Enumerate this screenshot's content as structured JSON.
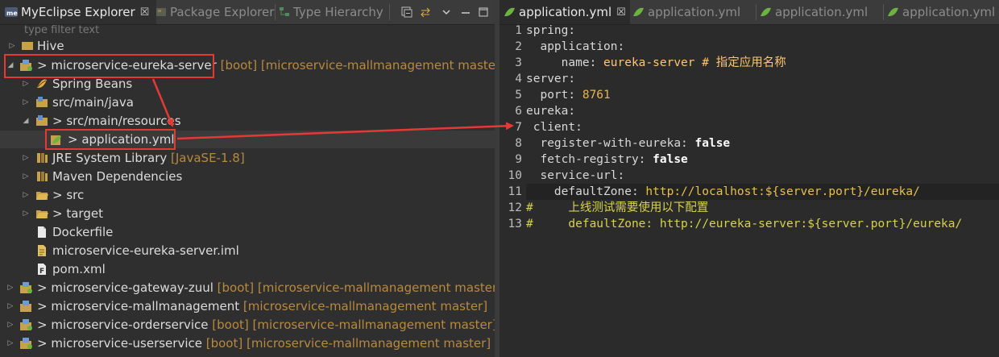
{
  "left_panel": {
    "tabs": [
      {
        "label": "MyEclipse Explorer",
        "icon": "me-icon",
        "active": true
      },
      {
        "label": "Package Explorer",
        "icon": "package-icon",
        "active": false
      },
      {
        "label": "Type Hierarchy",
        "icon": "hierarchy-icon",
        "active": false
      }
    ],
    "tab_close": "☒",
    "filter_placeholder": "type filter text",
    "tree": [
      {
        "text": "Hive",
        "decoration": ""
      },
      {
        "text": "> microservice-eureka-server",
        "decoration": " [boot] [microservice-mallmanagement master]"
      },
      {
        "text": "Spring Beans",
        "decoration": ""
      },
      {
        "text": "src/main/java",
        "decoration": ""
      },
      {
        "text": "> src/main/resources",
        "decoration": ""
      },
      {
        "text": "> application.yml",
        "decoration": ""
      },
      {
        "text": "JRE System Library",
        "decoration": " [JavaSE-1.8]"
      },
      {
        "text": "Maven Dependencies",
        "decoration": ""
      },
      {
        "text": "> src",
        "decoration": ""
      },
      {
        "text": "> target",
        "decoration": ""
      },
      {
        "text": "Dockerfile",
        "decoration": ""
      },
      {
        "text": "microservice-eureka-server.iml",
        "decoration": ""
      },
      {
        "text": "pom.xml",
        "decoration": ""
      },
      {
        "text": "> microservice-gateway-zuul",
        "decoration": " [boot] [microservice-mallmanagement master]"
      },
      {
        "text": "> microservice-mallmanagement",
        "decoration": " [microservice-mallmanagement master]"
      },
      {
        "text": "> microservice-orderservice",
        "decoration": " [boot] [microservice-mallmanagement master]"
      },
      {
        "text": "> microservice-userservice",
        "decoration": " [boot] [microservice-mallmanagement master]"
      }
    ]
  },
  "editor": {
    "tabs": [
      {
        "label": "application.yml",
        "active": true
      },
      {
        "label": "application.yml",
        "active": false
      },
      {
        "label": "application.yml",
        "active": false
      },
      {
        "label": "application.yml",
        "active": false
      }
    ],
    "tab_close": "☒",
    "lines": [
      {
        "n": "1",
        "k": "spring:",
        "v": ""
      },
      {
        "n": "2",
        "k": "  application:",
        "v": ""
      },
      {
        "n": "3",
        "k": "     name: ",
        "v": "eureka-server # 指定应用名称"
      },
      {
        "n": "4",
        "k": "server:",
        "v": ""
      },
      {
        "n": "5",
        "k": "  port: ",
        "v": "8761"
      },
      {
        "n": "6",
        "k": "eureka:",
        "v": ""
      },
      {
        "n": "7",
        "k": " client:",
        "v": ""
      },
      {
        "n": "8",
        "k": "  register-with-eureka: ",
        "v": "false"
      },
      {
        "n": "9",
        "k": "  fetch-registry: ",
        "v": "false"
      },
      {
        "n": "10",
        "k": "  service-url:",
        "v": ""
      },
      {
        "n": "11",
        "k": "    defaultZone: ",
        "v": "http://localhost:${server.port}/eureka/"
      },
      {
        "n": "12",
        "k": "#",
        "v": "     上线测试需要使用以下配置"
      },
      {
        "n": "13",
        "k": "#",
        "v": "     defaultZone: http://eureka-server:${server.port}/eureka/"
      }
    ]
  },
  "colors": {
    "annotation_red": "#e53935",
    "editor_bg": "#2b2b2b",
    "decoration": "#b9893c"
  }
}
